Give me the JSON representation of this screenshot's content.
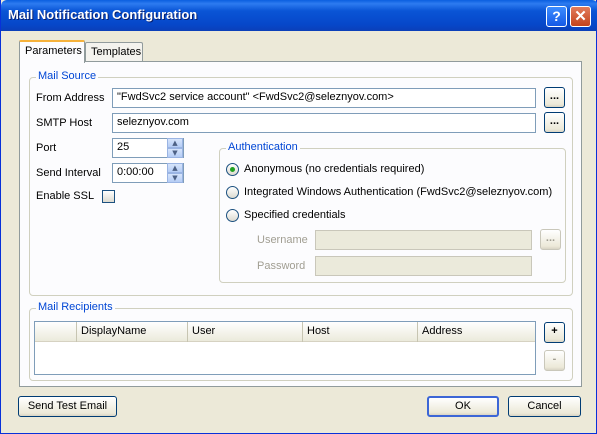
{
  "window": {
    "title": "Mail Notification Configuration",
    "help_glyph": "?",
    "close_glyph": "✕"
  },
  "tabs": [
    {
      "label": "Parameters",
      "active": true
    },
    {
      "label": "Templates",
      "active": false
    }
  ],
  "mail_source": {
    "legend": "Mail Source",
    "from_address": {
      "label": "From Address",
      "value": "\"FwdSvc2 service account\" <FwdSvc2@seleznyov.com>"
    },
    "smtp_host": {
      "label": "SMTP Host",
      "value": "seleznyov.com"
    },
    "port": {
      "label": "Port",
      "value": "25"
    },
    "send_interval": {
      "label": "Send Interval",
      "value": "0:00:00"
    },
    "enable_ssl": {
      "label": "Enable SSL",
      "checked": false
    },
    "browse_label": "..."
  },
  "authentication": {
    "legend": "Authentication",
    "options": [
      {
        "label": "Anonymous (no credentials required)",
        "checked": true
      },
      {
        "label": "Integrated Windows Authentication (FwdSvc2@seleznyov.com)",
        "checked": false
      },
      {
        "label": "Specified credentials",
        "checked": false
      }
    ],
    "username": {
      "label": "Username",
      "value": ""
    },
    "password": {
      "label": "Password",
      "value": ""
    },
    "browse_label": "..."
  },
  "mail_recipients": {
    "legend": "Mail Recipients",
    "columns": [
      "",
      "DisplayName",
      "User",
      "Host",
      "Address"
    ],
    "rows": [],
    "add_label": "+",
    "remove_label": "-"
  },
  "footer": {
    "send_test": "Send Test Email",
    "ok": "OK",
    "cancel": "Cancel"
  },
  "colors": {
    "title_bar": "#0a55d6",
    "group_legend": "#0046d5",
    "dialog_bg": "#ece9d8",
    "tab_accent": "#f6b23b",
    "radio_dot": "#21a121"
  }
}
